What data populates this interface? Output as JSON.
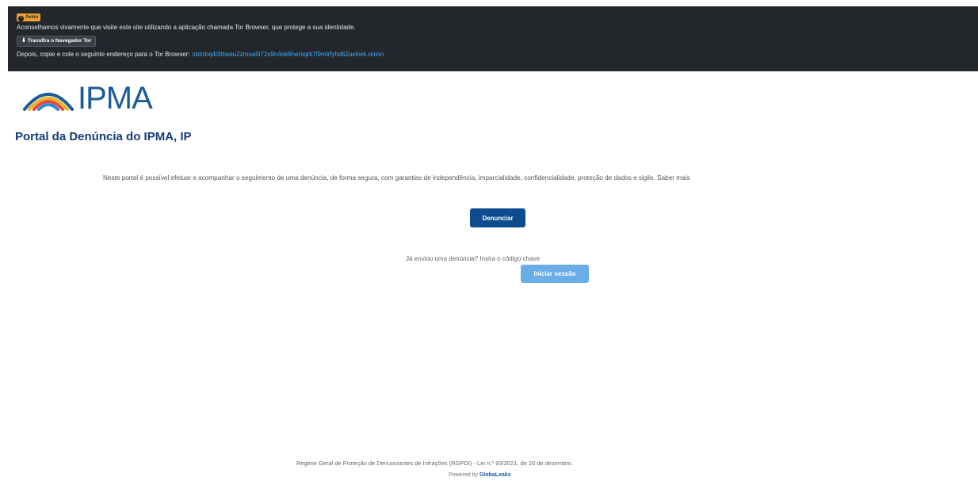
{
  "tor_banner": {
    "alert_label": "Aviso",
    "advice": "Aconselhamos vivamente que visite este site utilizando a aplicação chamada Tor Browser, que protege a sua identidade.",
    "download_label": "Transfira o Navegador Tor",
    "then_copy": "Depois, copie e cole o seguinte endereço para o Tor Browser:",
    "onion_address": "xbtrrbq4l3thaeu2zmua5l72s9n4ek6hersqrk7l9mlrfyhd62ueliwk.onion"
  },
  "logo": {
    "text": "IPMA",
    "arc_colors": [
      "#1a5c9a",
      "#f0b429",
      "#e64b3c",
      "#2e8bd6"
    ]
  },
  "page_title": "Portal da Denúncia do IPMA, IP",
  "intro": {
    "text": "Neste portal é possível efetuar e acompanhar o seguimento de uma denúncia, de forma segura, com garantias de independência, imparcialidade, confidencialidade, proteção de dados e sigilo.",
    "more_link": "Saber mais"
  },
  "actions": {
    "report_label": "Denunciar",
    "receipt_prompt": "Já enviou uma denúncia? Insira o código chave",
    "login_label": "Iniciar sessão"
  },
  "footer": {
    "law_text": "Regime Geral de Proteção de Denunciantes de Infrações (RGPDI) - Lei n.º 93/2021, de 20 de dezembro",
    "powered_prefix": "Powered by",
    "powered_brand": "GlobaLeaks"
  }
}
